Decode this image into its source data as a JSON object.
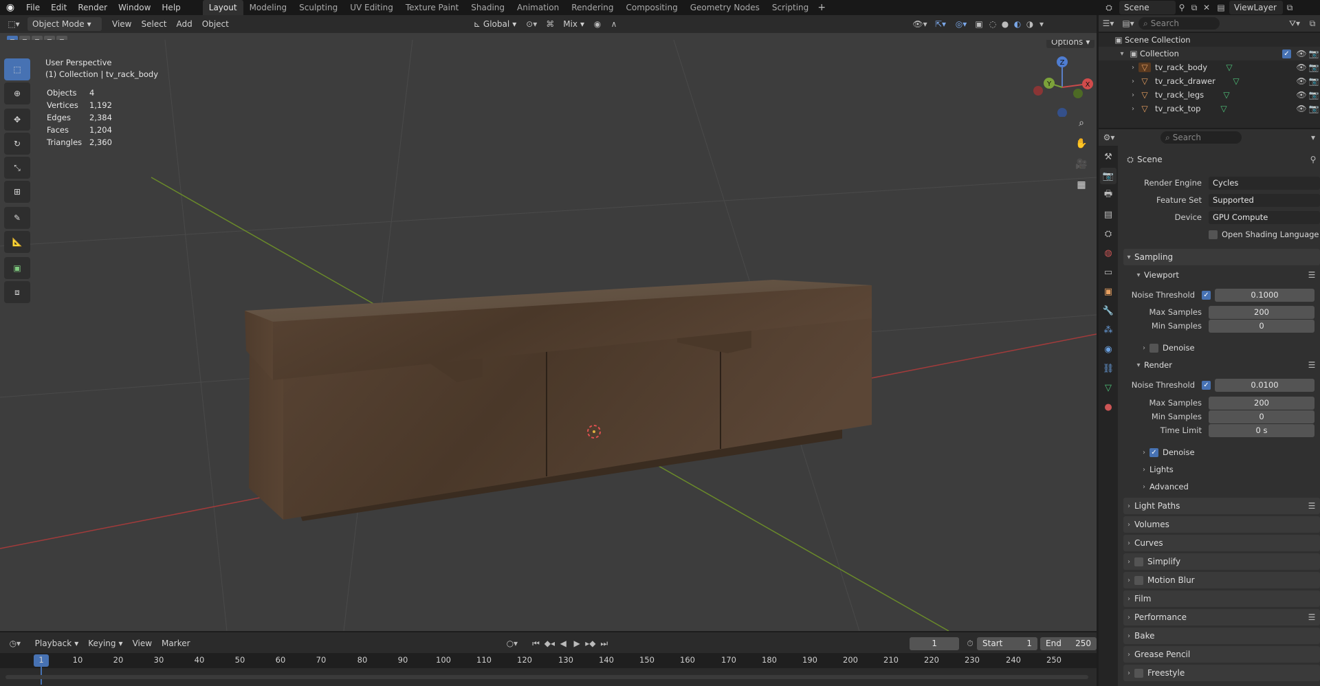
{
  "topbar": {
    "menus": [
      "File",
      "Edit",
      "Render",
      "Window",
      "Help"
    ],
    "workspaces": [
      "Layout",
      "Modeling",
      "Sculpting",
      "UV Editing",
      "Texture Paint",
      "Shading",
      "Animation",
      "Rendering",
      "Compositing",
      "Geometry Nodes",
      "Scripting"
    ],
    "active_workspace": "Layout",
    "scene_name": "Scene",
    "view_layer": "ViewLayer"
  },
  "viewport_header": {
    "mode": "Object Mode",
    "menus": [
      "View",
      "Select",
      "Add",
      "Object"
    ],
    "orientation": "Global",
    "snap_mode": "Mix",
    "options_label": "Options"
  },
  "viewport": {
    "perspective": "User Perspective",
    "context": "(1) Collection | tv_rack_body",
    "stats": [
      {
        "label": "Objects",
        "value": "4"
      },
      {
        "label": "Vertices",
        "value": "1,192"
      },
      {
        "label": "Edges",
        "value": "2,384"
      },
      {
        "label": "Faces",
        "value": "1,204"
      },
      {
        "label": "Triangles",
        "value": "2,360"
      }
    ],
    "gizmo": {
      "x": "X",
      "y": "Y",
      "z": "Z"
    }
  },
  "outliner": {
    "search_placeholder": "Search",
    "scene_collection": "Scene Collection",
    "collection": "Collection",
    "objects": [
      "tv_rack_body",
      "tv_rack_drawer",
      "tv_rack_legs",
      "tv_rack_top"
    ]
  },
  "properties": {
    "search_placeholder": "Search",
    "context": "Scene",
    "render_engine_label": "Render Engine",
    "render_engine": "Cycles",
    "feature_set_label": "Feature Set",
    "feature_set": "Supported",
    "device_label": "Device",
    "device": "GPU Compute",
    "osl_label": "Open Shading Language",
    "sampling": "Sampling",
    "viewport": {
      "title": "Viewport",
      "noise_threshold_label": "Noise Threshold",
      "noise_threshold": "0.1000",
      "max_samples_label": "Max Samples",
      "max_samples": "200",
      "min_samples_label": "Min Samples",
      "min_samples": "0",
      "denoise": "Denoise"
    },
    "render": {
      "title": "Render",
      "noise_threshold_label": "Noise Threshold",
      "noise_threshold": "0.0100",
      "max_samples_label": "Max Samples",
      "max_samples": "200",
      "min_samples_label": "Min Samples",
      "min_samples": "0",
      "time_limit_label": "Time Limit",
      "time_limit": "0 s",
      "denoise": "Denoise"
    },
    "lights": "Lights",
    "advanced": "Advanced",
    "panels": [
      "Light Paths",
      "Volumes",
      "Curves",
      "Simplify",
      "Motion Blur",
      "Film",
      "Performance",
      "Bake",
      "Grease Pencil",
      "Freestyle"
    ]
  },
  "timeline": {
    "menus": [
      "Playback",
      "Keying",
      "View",
      "Marker"
    ],
    "current_frame": "1",
    "start_label": "Start",
    "start": "1",
    "end_label": "End",
    "end": "250",
    "ruler": [
      "1",
      "10",
      "20",
      "30",
      "40",
      "50",
      "60",
      "70",
      "80",
      "90",
      "100",
      "110",
      "120",
      "130",
      "140",
      "150",
      "160",
      "170",
      "180",
      "190",
      "200",
      "210",
      "220",
      "230",
      "240",
      "250"
    ]
  }
}
